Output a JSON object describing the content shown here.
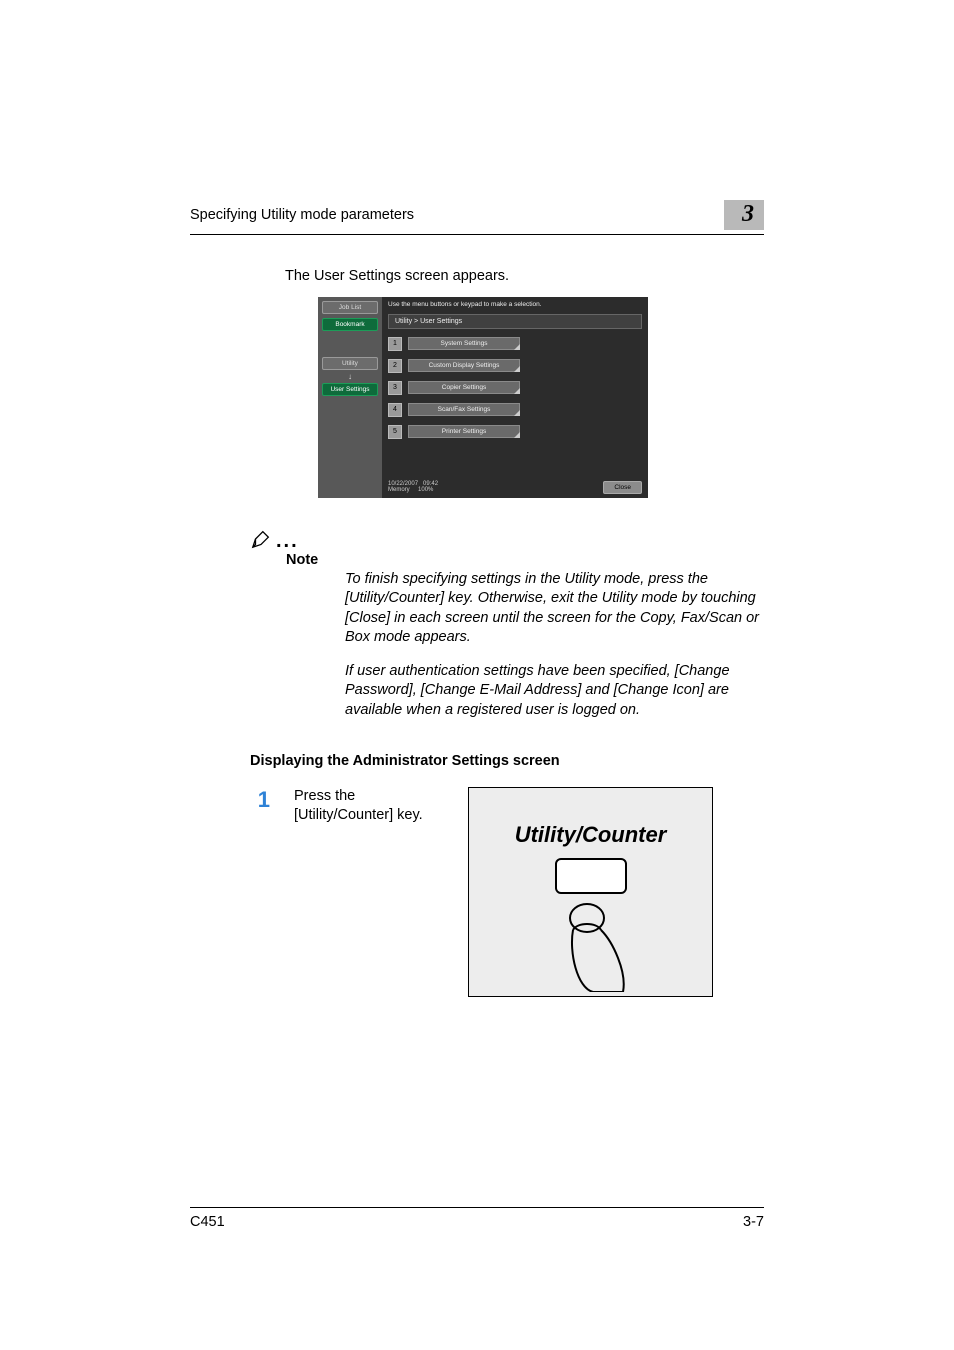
{
  "header": {
    "title": "Specifying Utility mode parameters",
    "chapter": "3"
  },
  "intro": "The User Settings screen appears.",
  "screen": {
    "top_hint": "Use the menu buttons or keypad to make a selection.",
    "left": {
      "job_list": "Job List",
      "bookmark": "Bookmark",
      "utility": "Utility",
      "user_settings": "User Settings"
    },
    "breadcrumb": "Utility > User Settings",
    "menu": [
      {
        "num": "1",
        "label": "System Settings"
      },
      {
        "num": "2",
        "label": "Custom Display Settings"
      },
      {
        "num": "3",
        "label": "Copier Settings"
      },
      {
        "num": "4",
        "label": "Scan/Fax Settings"
      },
      {
        "num": "5",
        "label": "Printer Settings"
      }
    ],
    "footer": {
      "date": "10/22/2007",
      "time": "09:42",
      "memory_label": "Memory",
      "memory_value": "100%",
      "close": "Close"
    }
  },
  "note": {
    "label": "Note",
    "para1": "To finish specifying settings in the Utility mode, press the [Utility/Counter] key. Otherwise, exit the Utility mode by touching [Close] in each screen until the screen for the Copy, Fax/Scan or Box mode appears.",
    "para2": "If user authentication settings have been specified, [Change Password], [Change E-Mail Address] and [Change Icon] are available when a registered user is logged on."
  },
  "subheading": "Displaying the Administrator Settings screen",
  "step": {
    "num": "1",
    "text": "Press the [Utility/Counter] key."
  },
  "key_illustration": {
    "label": "Utility/Counter"
  },
  "footer": {
    "model": "C451",
    "page": "3-7"
  }
}
